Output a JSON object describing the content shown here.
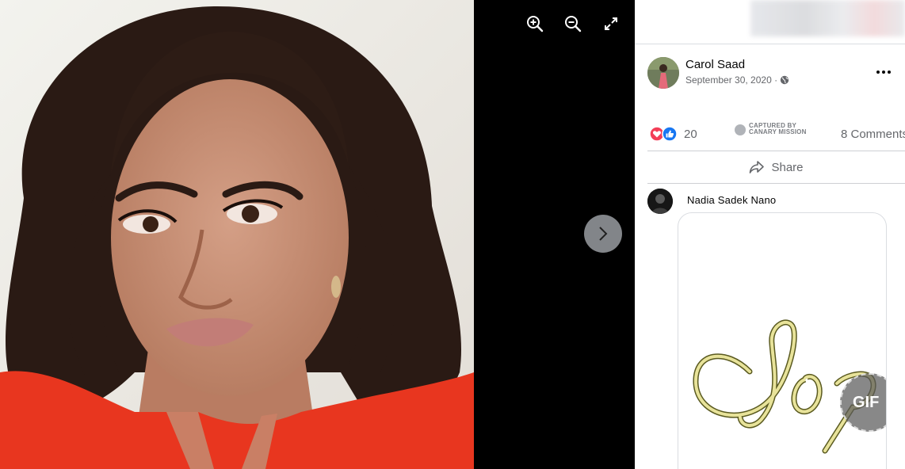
{
  "viewer": {
    "toolbar": {
      "zoom_in": "zoom-in-icon",
      "zoom_out": "zoom-out-icon",
      "fullscreen": "fullscreen-icon"
    },
    "next": "chevron-right-icon",
    "photo": {
      "colors": {
        "top": "#f4f4ef",
        "hair": "#2a1a14",
        "skin": "#c98f74",
        "dress": "#e8361f"
      }
    }
  },
  "post": {
    "author": "Carol Saad",
    "date": "September 30, 2020 · ",
    "privacy_icon": "globe-icon",
    "more_icon": "more-icon",
    "reactions": {
      "count": "20",
      "types": [
        "love",
        "like"
      ]
    },
    "watermark": {
      "line1": "CAPTURED BY",
      "line2": "CANARY MISSION"
    },
    "comments_count": "8 Comments",
    "share_label": "Share",
    "comment": {
      "author": "Nadia Sadek Nano",
      "gif_badge": "GIF",
      "gif_script_color": "#e8e39a"
    }
  },
  "colors": {
    "viewer_bg": "#000000",
    "panel_bg": "#ffffff",
    "love": "#f33e58",
    "like": "#1877f2",
    "muted_text": "#65676b"
  }
}
